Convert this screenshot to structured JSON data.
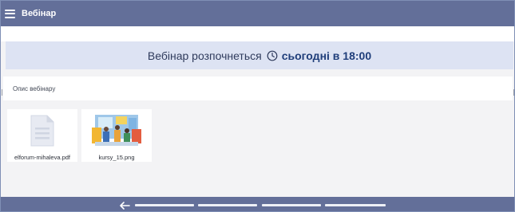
{
  "header": {
    "title": "Вебінар",
    "menu_icon": "hamburger-menu-icon"
  },
  "banner": {
    "text": "Вебінар розпочнеться",
    "time": "сьогодні в 18:00",
    "icon": "clock-icon",
    "background": "#dde3f3",
    "time_color": "#1f3e7a"
  },
  "description": {
    "label": "Опис вебінару"
  },
  "files": [
    {
      "name": "elforum-mihaleva.pdf",
      "icon": "document-icon"
    },
    {
      "name": "kursy_15.png",
      "icon": "image-thumbnail"
    }
  ],
  "footer": {
    "back_icon": "back-arrow-icon",
    "segments": 4
  },
  "colors": {
    "bar": "#636f99",
    "page_background": "#f3f3f5"
  }
}
